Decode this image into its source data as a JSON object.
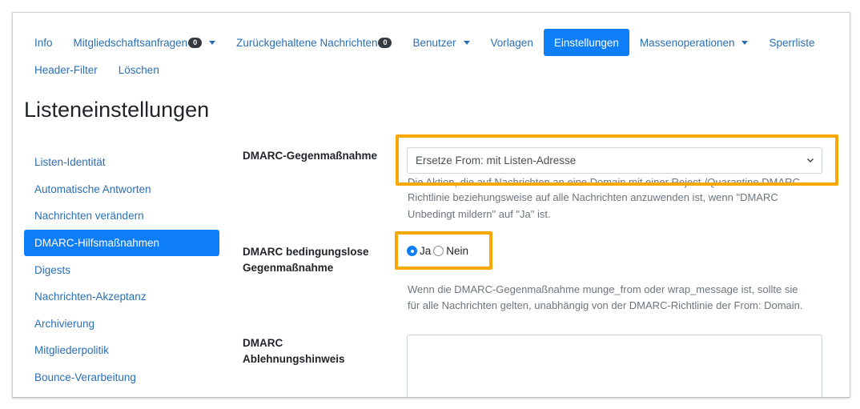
{
  "nav": {
    "items": [
      {
        "label": "Info"
      },
      {
        "label": "Mitgliedschaftsanfragen",
        "badge": "0"
      },
      {
        "label": "Zurückgehaltene Nachrichten",
        "badge": "0"
      },
      {
        "label": "Benutzer"
      },
      {
        "label": "Vorlagen"
      },
      {
        "label": "Einstellungen"
      },
      {
        "label": "Massenoperationen"
      },
      {
        "label": "Sperrliste"
      },
      {
        "label": "Header-Filter"
      },
      {
        "label": "Löschen"
      }
    ],
    "active": "Einstellungen"
  },
  "page": {
    "title": "Listeneinstellungen"
  },
  "sidebar": {
    "items": [
      {
        "label": "Listen-Identität"
      },
      {
        "label": "Automatische Antworten"
      },
      {
        "label": "Nachrichten verändern"
      },
      {
        "label": "DMARC-Hilfsmaßnahmen"
      },
      {
        "label": "Digests"
      },
      {
        "label": "Nachrichten-Akzeptanz"
      },
      {
        "label": "Archivierung"
      },
      {
        "label": "Mitgliederpolitik"
      },
      {
        "label": "Bounce-Verarbeitung"
      }
    ],
    "active": "DMARC-Hilfsmaßnahmen"
  },
  "form": {
    "dmarc_action": {
      "label": "DMARC-Gegenmaßnahme",
      "value": "Ersetze From: mit Listen-Adresse",
      "help_line1": "Die Aktion, die auf Nachrichten an eine Domain mit einer Reject-/Quarantine DMARC-",
      "help_line2": "Richtlinie beziehungsweise auf alle Nachrichten anzuwenden ist, wenn \"DMARC",
      "help_line3": "Unbedingt mildern\" auf \"Ja\" ist."
    },
    "dmarc_unconditional": {
      "label_line1": "DMARC bedingungslose",
      "label_line2": "Gegenmaßnahme",
      "option_yes": "Ja",
      "option_no": "Nein",
      "selected": "Ja",
      "help_line1": "Wenn die DMARC-Gegenmaßnahme munge_from oder wrap_message ist, sollte sie",
      "help_line2": "für alle Nachrichten gelten, unabhängig von der DMARC-Richtlinie der From: Domain."
    },
    "dmarc_notice": {
      "label_line1": "DMARC",
      "label_line2": "Ablehnungshinweis",
      "value": ""
    }
  },
  "colors": {
    "accent": "#0d7ef7",
    "link": "#2a6fb5",
    "highlight": "#f9a800"
  }
}
